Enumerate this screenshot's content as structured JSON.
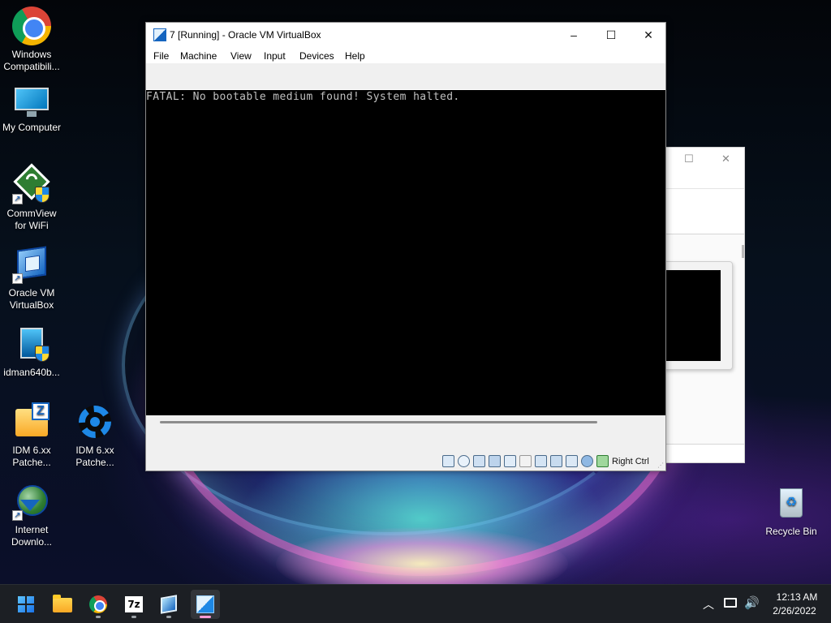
{
  "desktop": {
    "icons": [
      {
        "label": "Windows Compatibili...",
        "icon": "chrome-icon"
      },
      {
        "label": "My Computer",
        "icon": "monitor-icon"
      },
      {
        "label": "CommView for WiFi",
        "icon": "commview-icon"
      },
      {
        "label": "Oracle VM VirtualBox",
        "icon": "virtualbox-icon"
      },
      {
        "label": "idman640b...",
        "icon": "installer-icon"
      },
      {
        "label": "IDM 6.xx Patche...",
        "icon": "zip-folder-icon"
      },
      {
        "label": "IDM 6.xx Patche...",
        "icon": "gear-icon"
      },
      {
        "label": "Internet Downlo...",
        "icon": "idm-globe-icon"
      },
      {
        "label": "Recycle Bin",
        "icon": "recycle-bin-icon"
      }
    ]
  },
  "vm_window": {
    "title": "7 [Running] - Oracle VM VirtualBox",
    "controls": {
      "minimize": "–",
      "maximize": "☐",
      "close": "✕"
    },
    "menu": [
      "File",
      "Machine",
      "View",
      "Input",
      "Devices",
      "Help"
    ],
    "guest_screen_text": "FATAL: No bootable medium found! System halted.",
    "status_bar": {
      "host_key": "Right Ctrl",
      "icons": [
        "hard-disk-icon",
        "optical-drive-icon",
        "audio-icon",
        "network-icon",
        "usb-icon",
        "shared-folders-icon",
        "display-icon",
        "video-capture-icon",
        "vm-state-icon",
        "mouse-integration-icon",
        "keyboard-capture-icon"
      ]
    }
  },
  "background_window": {
    "controls": {
      "maximize": "☐",
      "close": "✕"
    }
  },
  "taskbar": {
    "apps": [
      "start-icon",
      "file-explorer-icon",
      "chrome-icon",
      "7zip-icon",
      "virtualbox-icon",
      "virtualbox-vm-icon"
    ],
    "active_app": "virtualbox-vm-icon",
    "tray": {
      "chevron": "︿",
      "volume": "🔊",
      "time": "12:13 AM",
      "date": "2/26/2022"
    }
  }
}
